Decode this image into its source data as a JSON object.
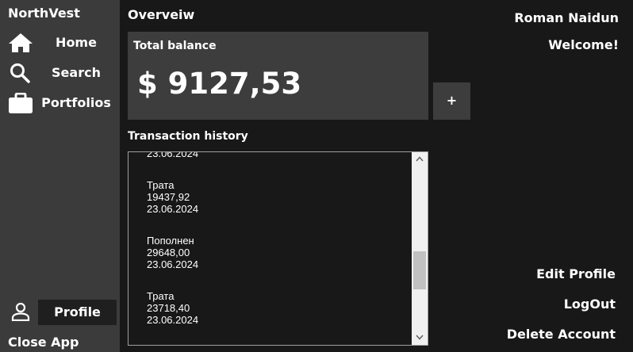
{
  "sidebar": {
    "app_title": "NorthVest",
    "items": [
      {
        "label": "Home",
        "icon": "home-icon"
      },
      {
        "label": "Search",
        "icon": "search-icon"
      },
      {
        "label": "Portfolios",
        "icon": "briefcase-icon"
      }
    ],
    "profile": {
      "label": "Profile",
      "icon": "user-icon"
    },
    "close_app": "Close App"
  },
  "main": {
    "title": "Overveiw",
    "balance": {
      "label": "Total balance",
      "value": "$ 9127,53"
    },
    "add_button": "+",
    "history": {
      "title": "Transaction history",
      "items": [
        {
          "type": "",
          "amount": "",
          "date": "23.06.2024"
        },
        {
          "type": "Трата",
          "amount": "19437,92",
          "date": "23.06.2024"
        },
        {
          "type": "Пополнен",
          "amount": "29648,00",
          "date": "23.06.2024"
        },
        {
          "type": "Трата",
          "amount": "23718,40",
          "date": "23.06.2024"
        }
      ]
    }
  },
  "user": {
    "name": "Roman Naidun",
    "welcome": "Welcome!",
    "edit_profile": "Edit Profile",
    "logout": "LogOut",
    "delete_account": "Delete Account"
  },
  "colors": {
    "background": "#181818",
    "sidebar": "#3b3b3b",
    "card": "#3d3d3d",
    "text": "#ffffff"
  }
}
